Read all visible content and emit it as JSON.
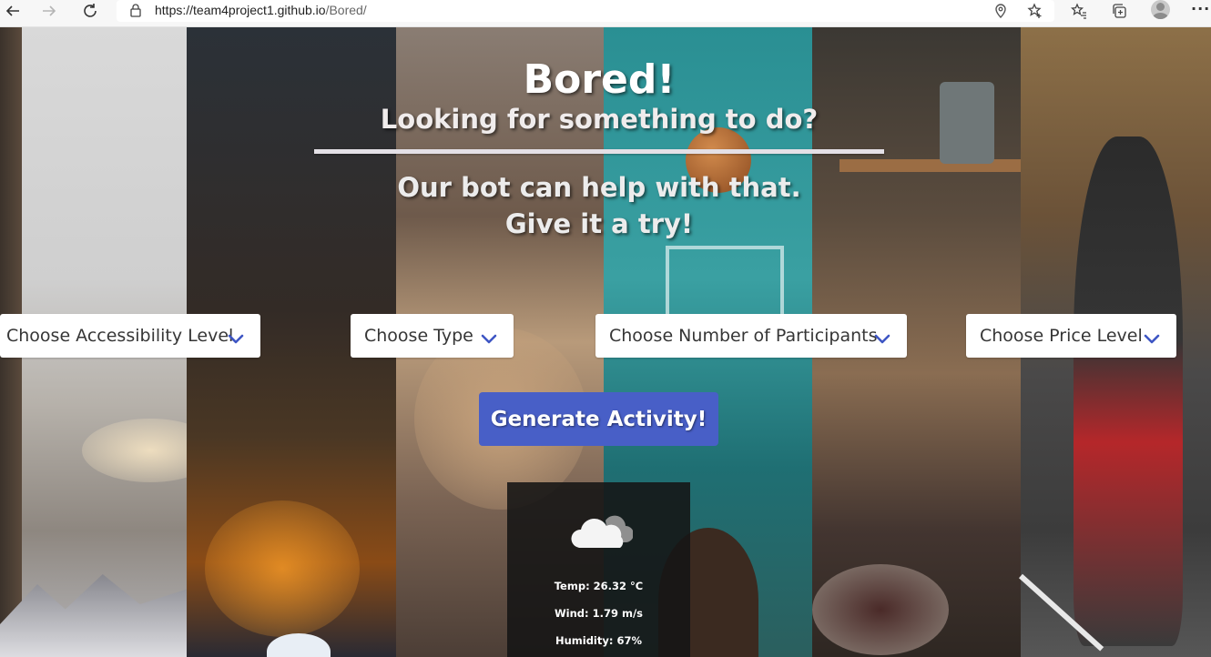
{
  "browser": {
    "url_host": "https://team4project1.github.io",
    "url_path": "/Bored/"
  },
  "hero": {
    "title": "Bored!",
    "subtitle": "Looking for something to do?",
    "tagline_line1": "Our bot can help with that.",
    "tagline_line2": "Give it a try!"
  },
  "filters": {
    "accessibility": "Choose Accessibility Level",
    "type": "Choose Type",
    "participants": "Choose Number of Participants",
    "price": "Choose Price Level"
  },
  "actions": {
    "generate_label": "Generate Activity!"
  },
  "weather": {
    "icon": "cloud-icon",
    "temp": "Temp: 26.32 °C",
    "wind": "Wind: 1.79 m/s",
    "humidity": "Humidity: 67%"
  },
  "colors": {
    "button_primary": "#485fc7",
    "chevron": "#3e56c4",
    "weather_bg": "#141414"
  }
}
